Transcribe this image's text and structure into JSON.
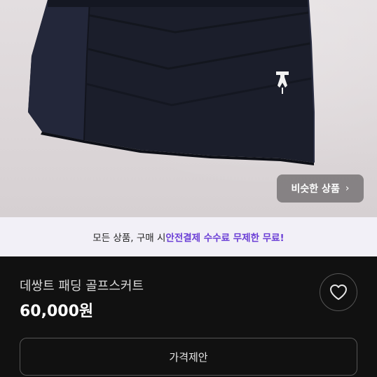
{
  "photo": {
    "similar_products_label": "비슷한 상품",
    "chevron": "›"
  },
  "promo": {
    "prefix": "모든 상품, 구매 시 ",
    "highlight": "안전결제 수수료 무제한 무료!"
  },
  "product": {
    "title": "데쌍트 패딩 골프스커트",
    "price": "60,000원"
  },
  "actions": {
    "offer_label": "가격제안"
  },
  "colors": {
    "accent": "#6b3fd6",
    "background": "#111111",
    "banner": "#f2f0f7"
  }
}
